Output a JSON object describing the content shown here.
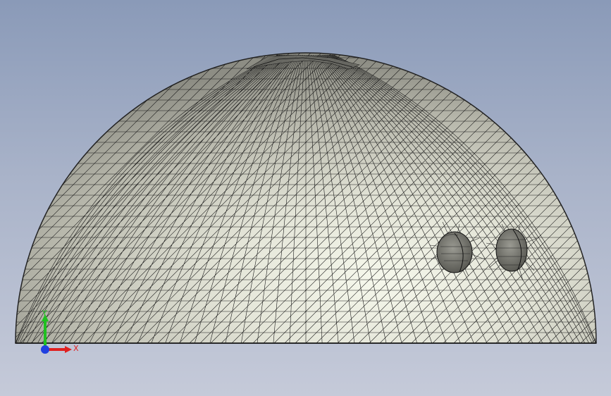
{
  "viewport": {
    "background_top": "#8a9ab8",
    "background_bottom": "#c5cad9"
  },
  "model": {
    "surface_color": "#d9d9cc",
    "highlight_color": "#f4f6ea",
    "mesh_color": "#1a1a1a",
    "features": [
      "hemisphere-dome",
      "mesh-grid",
      "hole-left",
      "hole-right",
      "apex-mesh-cluster"
    ]
  },
  "triad": {
    "x_label": "X",
    "y_label": "Y",
    "x_color": "#e02020",
    "y_color": "#20c020",
    "z_color": "#2040e0"
  }
}
